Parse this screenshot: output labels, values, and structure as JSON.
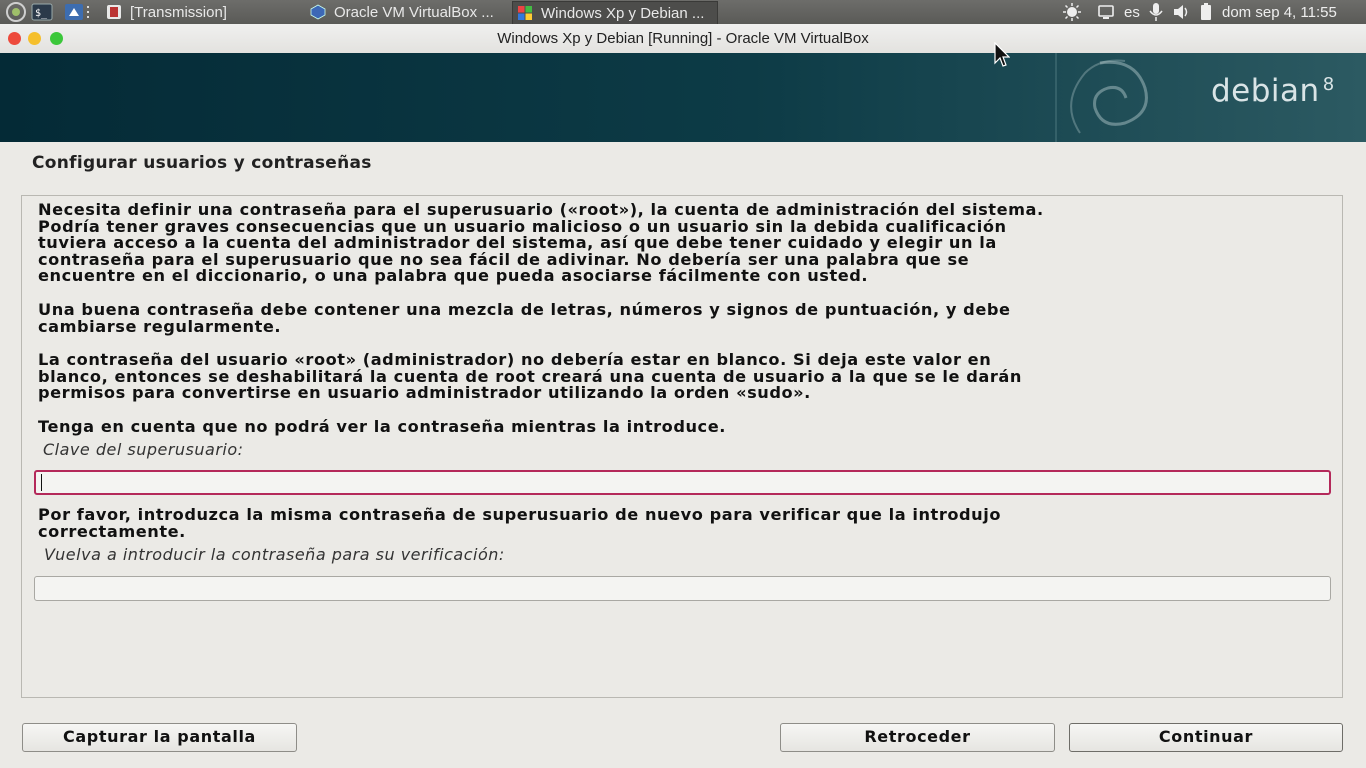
{
  "panel": {
    "tasks": [
      {
        "label": "[Transmission]"
      },
      {
        "label": "Oracle VM VirtualBox ..."
      },
      {
        "label": "Windows Xp y Debian ..."
      }
    ],
    "keyboard": "es",
    "clock": "dom sep  4, 11:55"
  },
  "window": {
    "title": "Windows Xp y Debian [Running] - Oracle VM VirtualBox"
  },
  "banner": {
    "brand": "debian",
    "version": "8"
  },
  "installer": {
    "section_title": "Configurar usuarios y contraseñas",
    "paragraphs": [
      "Necesita definir una contraseña para el superusuario («root»), la cuenta de administración del sistema.\nPodría tener graves consecuencias que un usuario malicioso o un usuario sin la debida cualificación\ntuviera acceso a la cuenta del administrador del sistema, así que debe tener cuidado y elegir un la\ncontraseña para el superusuario que no sea fácil de adivinar. No debería ser una palabra que se\nencuentre en el diccionario, o una palabra que pueda asociarse fácilmente con usted.",
      "Una buena contraseña debe contener una mezcla de letras, números y signos de puntuación, y debe\ncambiarse regularmente.",
      "La contraseña del usuario «root» (administrador) no debería estar en blanco. Si deja este valor en\nblanco, entonces se deshabilitará la cuenta de root creará una cuenta de usuario a la que se le darán\npermisos para convertirse en usuario administrador utilizando la orden «sudo».",
      "Tenga en cuenta que no podrá ver la contraseña mientras la introduce."
    ],
    "password_label": "Clave del superusuario:",
    "password_value": "",
    "verify_text": "Por favor, introduzca la misma contraseña de superusuario de nuevo para verificar que la introdujo\ncorrectamente.",
    "verify_label": "Vuelva a introducir la contraseña para su verificación:",
    "verify_value": ""
  },
  "buttons": {
    "screenshot": "Capturar la pantalla",
    "back": "Retroceder",
    "continue": "Continuar"
  },
  "colors": {
    "focus_border": "#b4295a",
    "banner_bg": "#042a36",
    "close": "#ed4a3c",
    "minimize": "#f5bf2c",
    "maximize": "#3bc73a"
  },
  "icons": [
    "terminal-icon",
    "files-icon",
    "transmission-icon",
    "virtualbox-icon",
    "windows-icon",
    "brightness-icon",
    "screen-icon",
    "microphone-icon",
    "volume-icon",
    "battery-icon",
    "debian-swirl-icon",
    "mouse-cursor-icon"
  ]
}
